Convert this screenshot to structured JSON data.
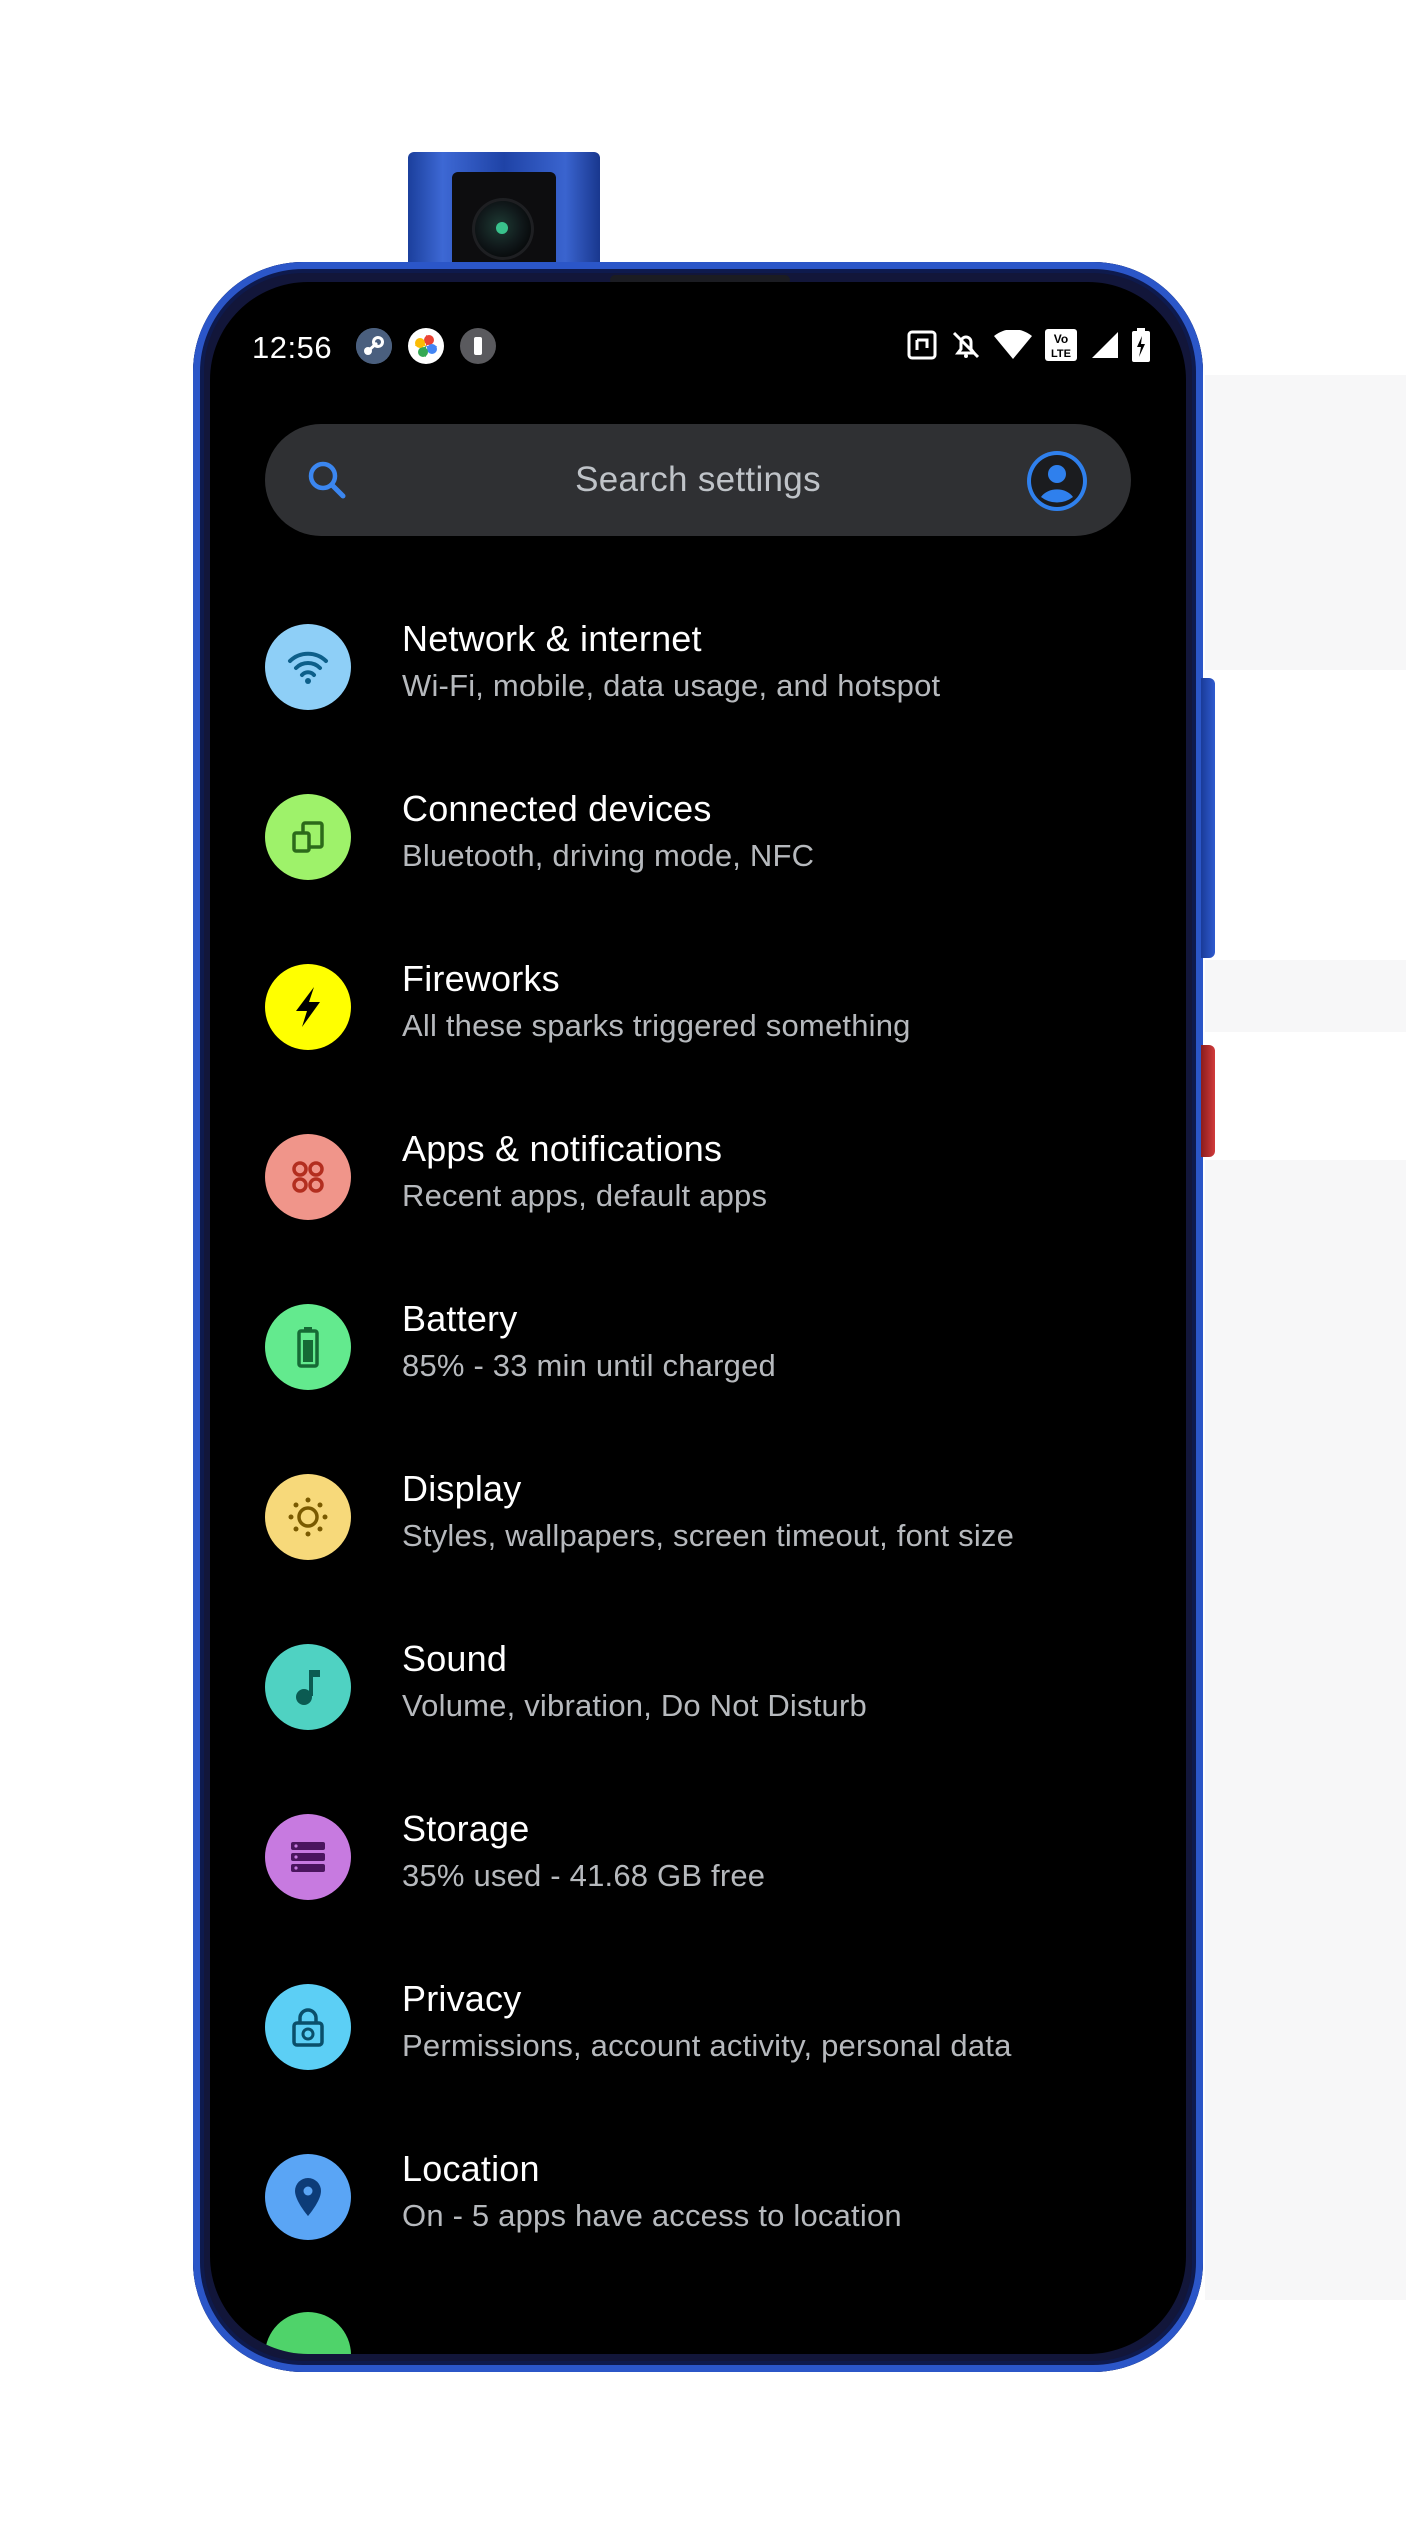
{
  "status_bar": {
    "time": "12:56",
    "notification_icons": [
      "steam-icon",
      "google-photos-icon",
      "battery-saver-icon"
    ],
    "system_icons": [
      "nfc-icon",
      "silent-mode-icon",
      "wifi-icon",
      "volte-icon",
      "signal-icon",
      "battery-charging-icon"
    ],
    "volte_label": "Vo\nLTE"
  },
  "search": {
    "placeholder": "Search settings"
  },
  "settings": [
    {
      "title": "Network & internet",
      "subtitle": "Wi-Fi, mobile, data usage, and hotspot",
      "icon": "wifi-icon",
      "color": "#8ecff7",
      "icon_color": "#0d5f8a"
    },
    {
      "title": "Connected devices",
      "subtitle": "Bluetooth, driving mode, NFC",
      "icon": "devices-icon",
      "color": "#9ef26a",
      "icon_color": "#2c6a1a"
    },
    {
      "title": "Fireworks",
      "subtitle": "All these sparks triggered something",
      "icon": "lightning-icon",
      "color": "#ffff00",
      "icon_color": "#000000"
    },
    {
      "title": "Apps & notifications",
      "subtitle": "Recent apps, default apps",
      "icon": "apps-icon",
      "color": "#f0958a",
      "icon_color": "#b32e1f"
    },
    {
      "title": "Battery",
      "subtitle": "85% - 33 min until charged",
      "icon": "battery-icon",
      "color": "#63ea8e",
      "icon_color": "#166a35"
    },
    {
      "title": "Display",
      "subtitle": "Styles, wallpapers, screen timeout, font size",
      "icon": "brightness-icon",
      "color": "#f7d97a",
      "icon_color": "#7a5a00"
    },
    {
      "title": "Sound",
      "subtitle": "Volume, vibration, Do Not Disturb",
      "icon": "music-note-icon",
      "color": "#4fd2c2",
      "icon_color": "#0b5b52"
    },
    {
      "title": "Storage",
      "subtitle": "35% used - 41.68 GB free",
      "icon": "storage-icon",
      "color": "#c77ae0",
      "icon_color": "#4a155e"
    },
    {
      "title": "Privacy",
      "subtitle": "Permissions, account activity, personal data",
      "icon": "privacy-icon",
      "color": "#5ccff5",
      "icon_color": "#0a4f6a"
    },
    {
      "title": "Location",
      "subtitle": "On - 5 apps have access to location",
      "icon": "location-pin-icon",
      "color": "#5aa5f5",
      "icon_color": "#0d3c78"
    }
  ],
  "colors": {
    "screen_background": "#000000",
    "search_background": "#2f3033",
    "accent_blue": "#2f80ed",
    "frame_blue": "#2b56c8"
  }
}
